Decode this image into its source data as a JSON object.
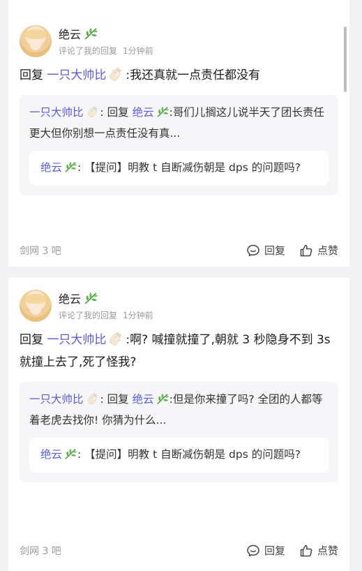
{
  "posts": [
    {
      "username": "绝云",
      "action_text": "评论了我的回复",
      "time": "1分钟前",
      "reply_prefix": "回复",
      "reply_target": "一只大帅比",
      "reply_text": ":我还真就一点责任都没有",
      "quote": {
        "author": "一只大帅比",
        "mid": ": 回复 ",
        "target": "绝云",
        "text": ":哥们儿搁这儿说半天了团长责任更大但你别想一点责任没有真..."
      },
      "inner_quote": {
        "author": "绝云",
        "text": ": 【提问】明教 t 自断减伤朝是 dps 的问题吗?"
      },
      "forum": "剑网 3 吧",
      "reply_label": "回复",
      "like_label": "点赞"
    },
    {
      "username": "绝云",
      "action_text": "评论了我的回复",
      "time": "1分钟前",
      "reply_prefix": "回复",
      "reply_target": "一只大帅比",
      "reply_text": ":啊? 喊撞就撞了,朝就 3 秒隐身不到 3s 就撞上去了,死了怪我?",
      "quote": {
        "author": "一只大帅比",
        "mid": ": 回复 ",
        "target": "绝云",
        "text": ":但是你来撞了吗? 全团的人都等着老虎去找你! 你猜为什么..."
      },
      "inner_quote": {
        "author": "绝云",
        "text": ": 【提问】明教 t 自断减伤朝是 dps 的问题吗?"
      },
      "forum": "剑网 3 吧",
      "reply_label": "回复",
      "like_label": "点赞"
    }
  ],
  "colors": {
    "link": "#5b5bd6",
    "meta": "#9a9aa0",
    "quote_bg": "#f6f6f8",
    "page_bg": "#f2f2f4"
  },
  "icons": [
    "leaf-icon",
    "milk-bottle-icon",
    "comment-icon",
    "thumbs-up-icon"
  ]
}
